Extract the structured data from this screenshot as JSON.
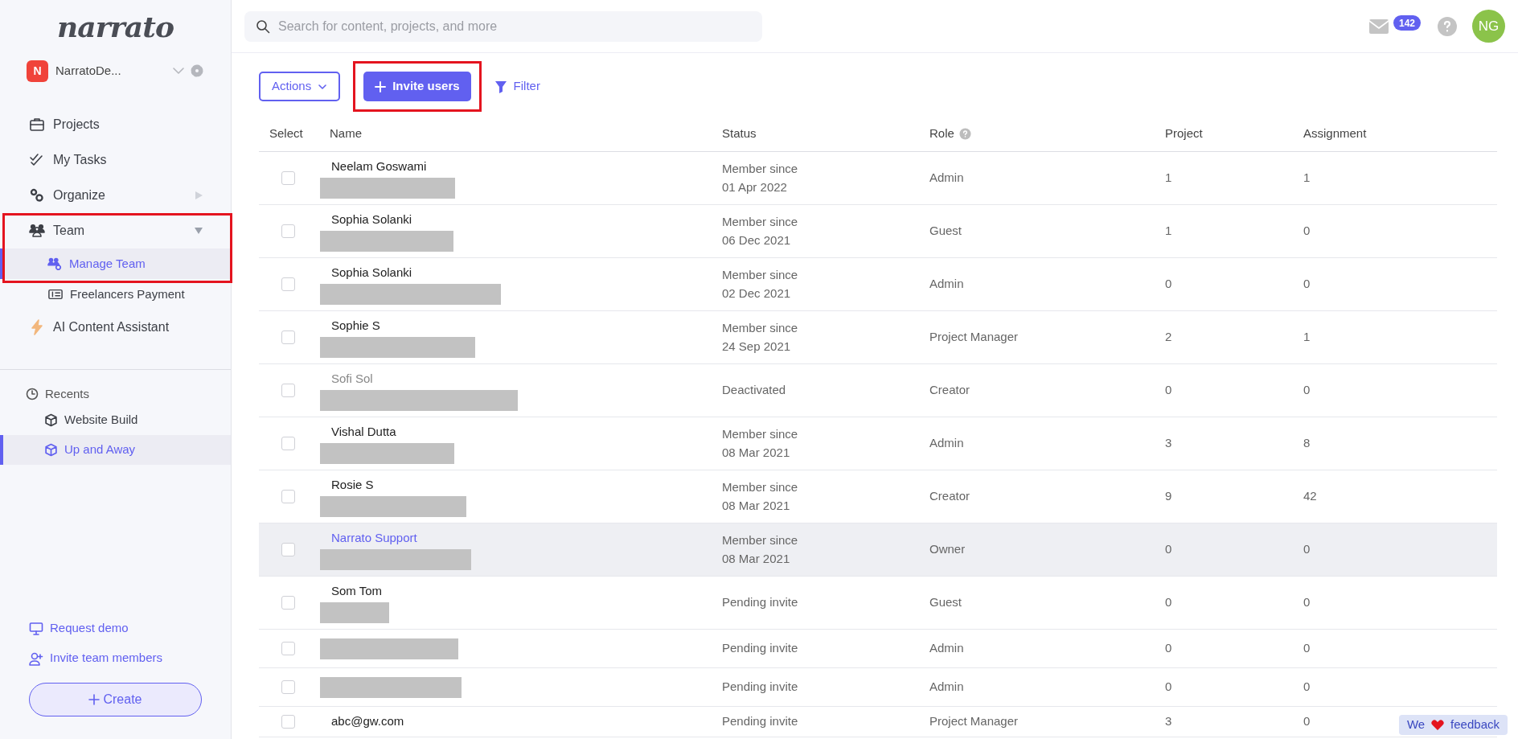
{
  "sidebar": {
    "logo": "narrato",
    "workspace": {
      "initial": "N",
      "name": "NarratoDe..."
    },
    "nav": [
      {
        "label": "Projects"
      },
      {
        "label": "My Tasks"
      },
      {
        "label": "Organize",
        "expanded": false
      },
      {
        "label": "Team",
        "expanded": true,
        "highlighted": true,
        "children": [
          {
            "label": "Manage Team",
            "selected": true
          },
          {
            "label": "Freelancers Payment",
            "selected": false
          }
        ]
      },
      {
        "label": "AI Content Assistant"
      }
    ],
    "recents": {
      "title": "Recents",
      "items": [
        {
          "label": "Website Build",
          "selected": false
        },
        {
          "label": "Up and Away",
          "selected": true
        }
      ]
    },
    "links": [
      "Request demo",
      "Invite team members"
    ],
    "create_button": "Create"
  },
  "topbar": {
    "search": {
      "placeholder": "Search for content, projects, and more"
    },
    "mail_badge": "142",
    "avatar": "NG"
  },
  "toolbar": {
    "actions": "Actions",
    "invite": {
      "label": "Invite users",
      "highlighted": true
    },
    "filter": "Filter"
  },
  "table": {
    "columns": [
      {
        "label": "Select"
      },
      {
        "label": "Name"
      },
      {
        "label": "Status"
      },
      {
        "label": "Role",
        "help": true
      },
      {
        "label": "Project"
      },
      {
        "label": "Assignment"
      }
    ],
    "rows": [
      {
        "checked": false,
        "name": "Neelam Goswami",
        "status": "Member since",
        "date": "01 Apr 2022",
        "role": "Admin",
        "project": "1",
        "assignment": "1",
        "deactivated": false,
        "link": false,
        "highlighted": false
      },
      {
        "checked": false,
        "name": "Sophia Solanki",
        "status": "Member since",
        "date": "06 Dec 2021",
        "role": "Guest",
        "project": "1",
        "assignment": "0",
        "deactivated": false,
        "link": false,
        "highlighted": false
      },
      {
        "checked": false,
        "name": "Sophia Solanki",
        "status": "Member since",
        "date": "02 Dec 2021",
        "role": "Admin",
        "project": "0",
        "assignment": "0",
        "deactivated": false,
        "link": false,
        "highlighted": false
      },
      {
        "checked": false,
        "name": "Sophie S",
        "status": "Member since",
        "date": "24 Sep 2021",
        "role": "Project Manager",
        "project": "2",
        "assignment": "1",
        "deactivated": false,
        "link": false,
        "highlighted": false
      },
      {
        "checked": false,
        "name": "Sofi Sol",
        "status": "Deactivated",
        "role": "Creator",
        "project": "0",
        "assignment": "0",
        "deactivated": true,
        "link": false,
        "highlighted": false
      },
      {
        "checked": false,
        "name": "Vishal Dutta",
        "status": "Member since",
        "date": "08 Mar 2021",
        "role": "Admin",
        "project": "3",
        "assignment": "8",
        "deactivated": false,
        "link": false,
        "highlighted": false
      },
      {
        "checked": false,
        "name": "Rosie S",
        "status": "Member since",
        "date": "08 Mar 2021",
        "role": "Creator",
        "project": "9",
        "assignment": "42",
        "deactivated": false,
        "link": false,
        "highlighted": false
      },
      {
        "checked": false,
        "name": "Narrato Support",
        "status": "Member since",
        "date": "08 Mar 2021",
        "role": "Owner",
        "project": "0",
        "assignment": "0",
        "deactivated": false,
        "link": true,
        "highlighted": true
      },
      {
        "checked": false,
        "name": "Som Tom",
        "status": "Pending invite",
        "role": "Guest",
        "project": "0",
        "assignment": "0",
        "deactivated": false,
        "link": false,
        "highlighted": false
      },
      {
        "checked": false,
        "status": "Pending invite",
        "role": "Admin",
        "project": "0",
        "assignment": "0",
        "highlighted": false
      },
      {
        "checked": false,
        "status": "Pending invite",
        "role": "Admin",
        "project": "0",
        "assignment": "0",
        "highlighted": false
      },
      {
        "checked": false,
        "name": "abc@gw.com",
        "status": "Pending invite",
        "role": "Project Manager",
        "project": "3",
        "assignment": "0",
        "deactivated": false,
        "link": false,
        "highlighted": false
      }
    ]
  },
  "feedback": {
    "before": "We",
    "after": "feedback"
  }
}
